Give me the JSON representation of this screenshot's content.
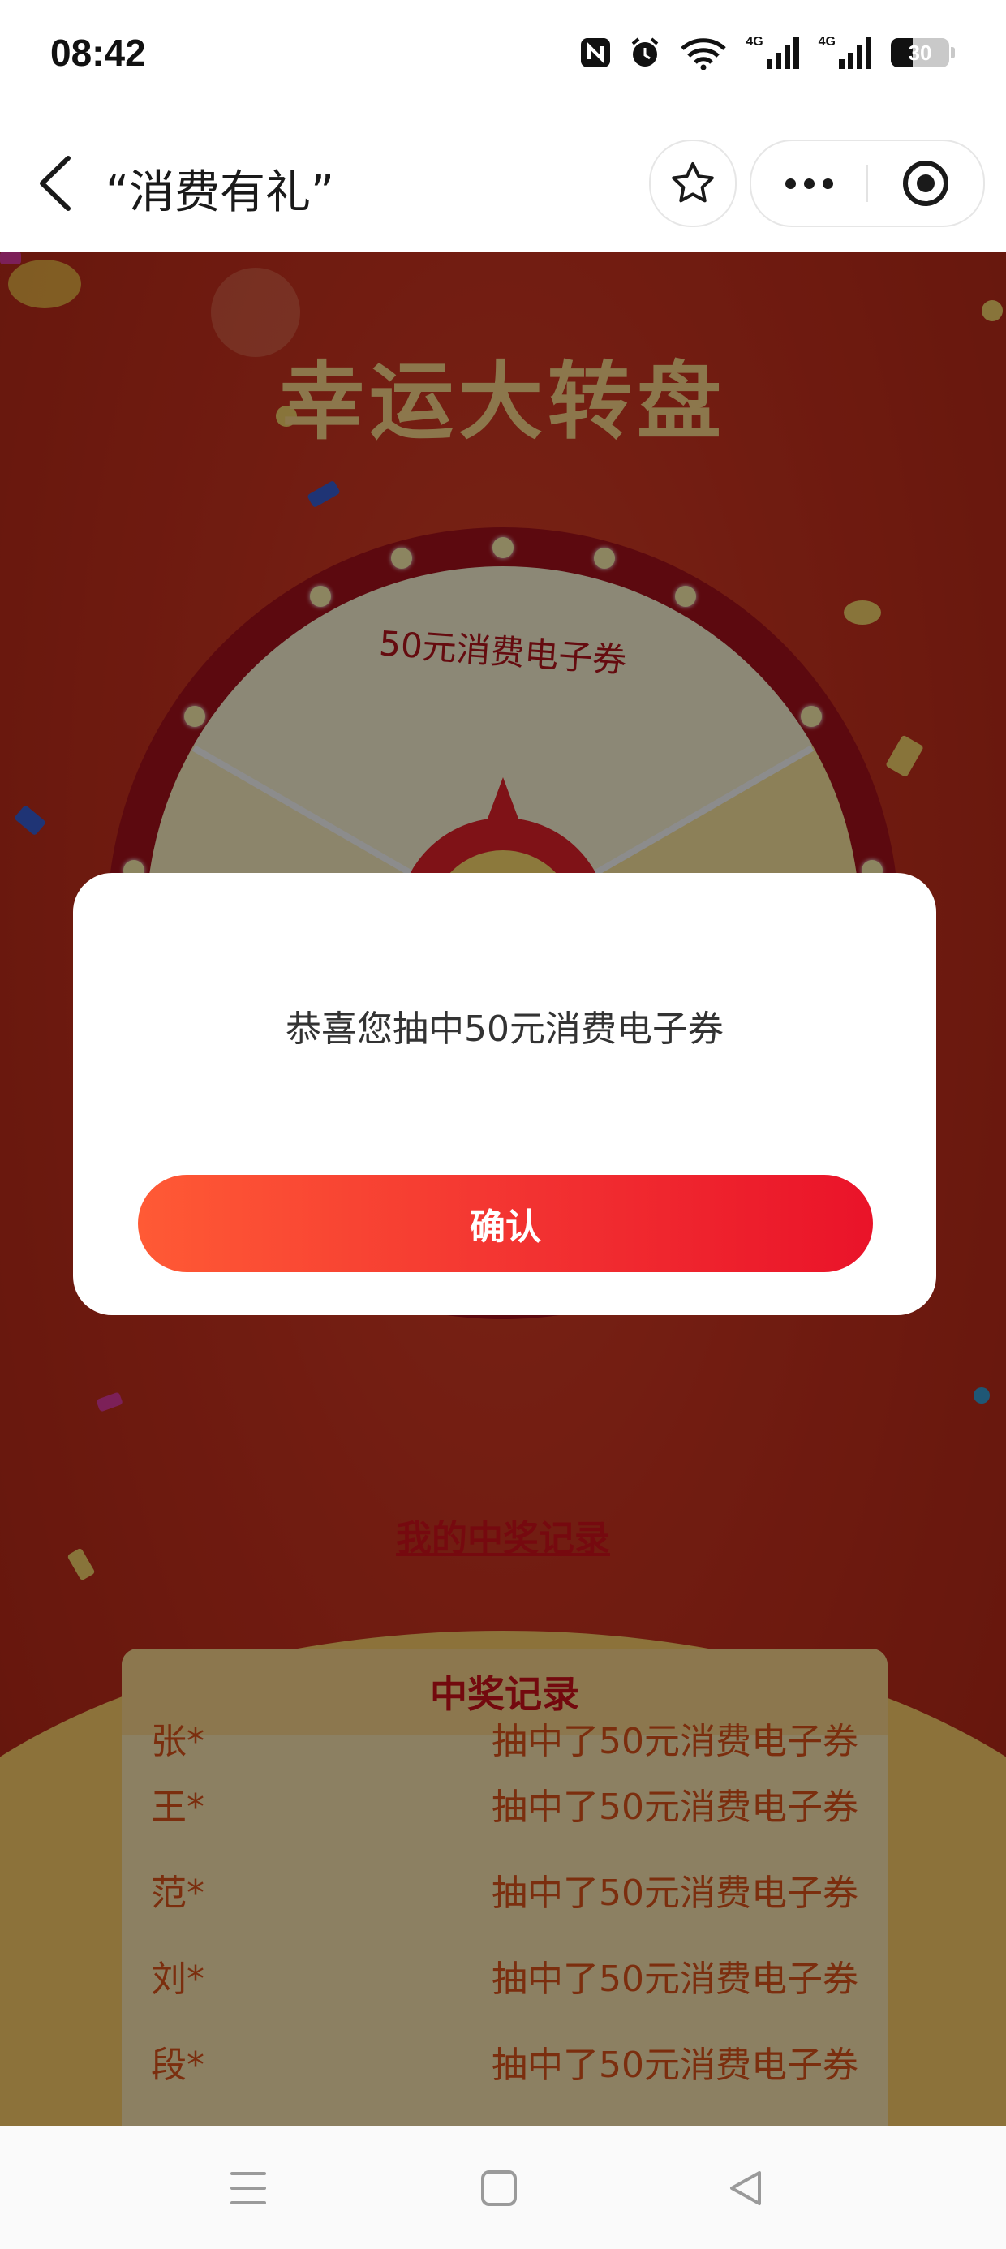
{
  "status_bar": {
    "time": "08:42",
    "icons": [
      "nfc-icon",
      "alarm-icon",
      "wifi-icon",
      "signal-4g-icon",
      "signal-4g-icon",
      "battery-icon"
    ],
    "network_labels": [
      "4G",
      "4G"
    ],
    "battery": "30"
  },
  "nav": {
    "title": "“消费有礼”",
    "back_icon": "chevron-left-icon",
    "favorite_icon": "star-outline-icon",
    "more_icon": "more-dots-icon",
    "target_icon": "target-icon"
  },
  "game": {
    "title": "幸运大转盘",
    "wheel_prize_label": "50元消费电子券",
    "records_link": "我的中奖记录"
  },
  "records": {
    "title": "中奖记录",
    "rows": [
      {
        "name": "张*",
        "prize": "抽中了50元消费电子券"
      },
      {
        "name": "王*",
        "prize": "抽中了50元消费电子券"
      },
      {
        "name": "范*",
        "prize": "抽中了50元消费电子券"
      },
      {
        "name": "刘*",
        "prize": "抽中了50元消费电子券"
      },
      {
        "name": "段*",
        "prize": "抽中了50元消费电子券"
      }
    ]
  },
  "modal": {
    "message": "恭喜您抽中50元消费电子券",
    "confirm_label": "确认"
  },
  "system_nav": {
    "buttons": [
      "menu-icon",
      "home-square-icon",
      "back-triangle-icon"
    ]
  },
  "colors": {
    "accent": "#ea1329",
    "accent_start": "#ff5a35",
    "background": "#cf3420",
    "title_gold": "#ffd98a",
    "record_text": "#e0541b"
  }
}
